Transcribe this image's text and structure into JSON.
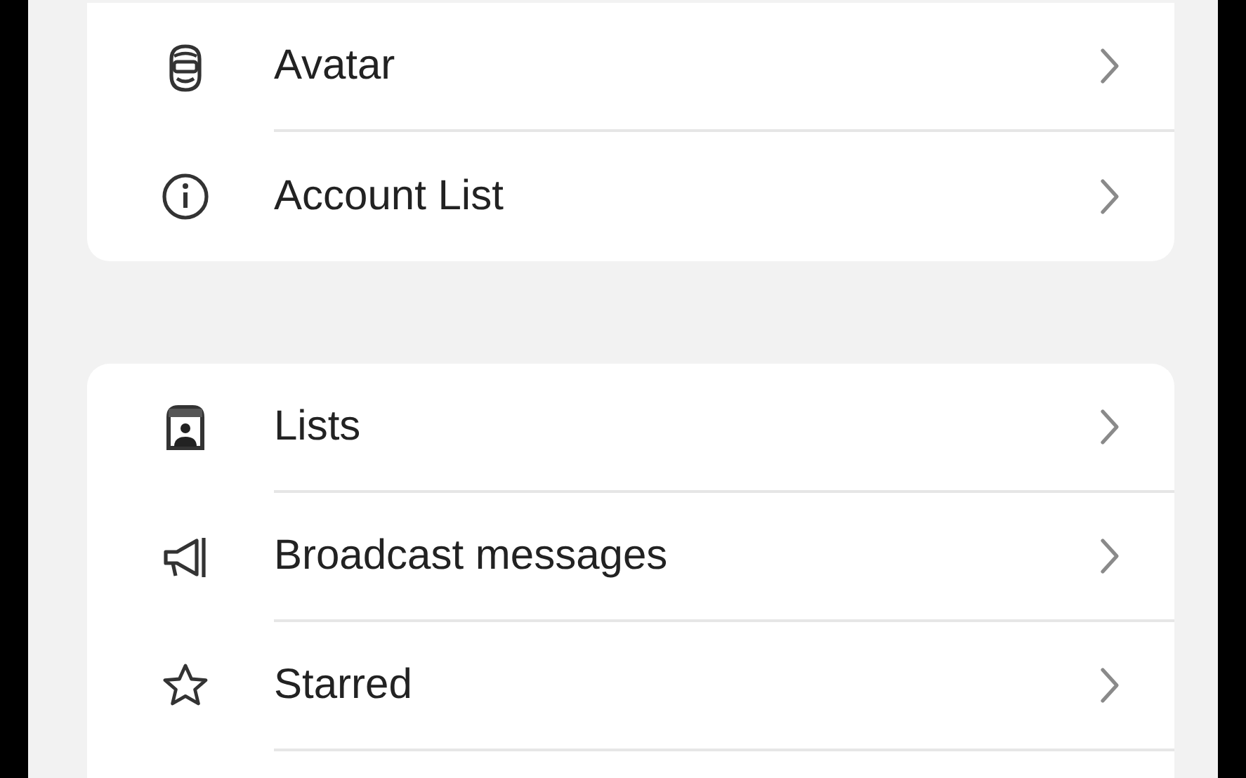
{
  "sections": [
    {
      "items": [
        {
          "label": "Avatar"
        },
        {
          "label": "Account List"
        }
      ]
    },
    {
      "items": [
        {
          "label": "Lists"
        },
        {
          "label": "Broadcast messages"
        },
        {
          "label": "Starred"
        }
      ]
    }
  ]
}
